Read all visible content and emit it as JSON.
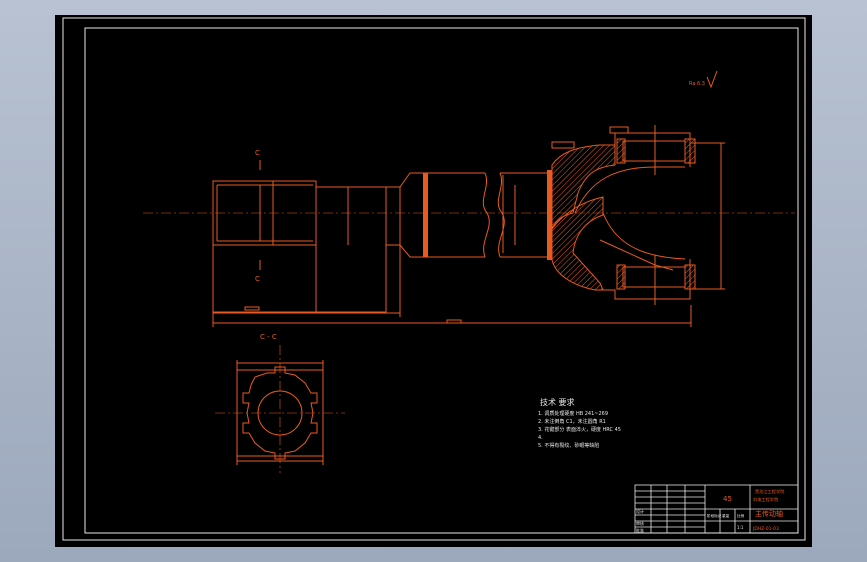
{
  "drawing": {
    "section_label_top": "C",
    "section_label_bottom": "C",
    "section_view_label": "C - C",
    "roughness_symbol": "Ra 6.3",
    "tech_req_title": "技术 要求",
    "tech_req_lines": [
      "1. 调质处理硬度 HB 241~269",
      "2. 未注倒角 C1，未注圆角 R1",
      "3. 花键部分 表面淬火，硬度 HRC 45",
      "4.",
      "5. 不得有裂纹、砂眼等缺陷"
    ],
    "title_block": {
      "material": "45",
      "school_line1": "黑龙江工程学院",
      "school_line2": "机电工程学院",
      "part_name": "主传动轴",
      "drawing_number": "JDHZ-01-03",
      "design_label": "设计",
      "check_label": "审核",
      "approve_label": "批准",
      "stage_label": "阶段标记",
      "weight_label": "重量",
      "scale_label": "比例",
      "scale_value": "1:1"
    }
  },
  "colors": {
    "line": "#e85a1f",
    "text": "#e8e8e8",
    "background": "#000000",
    "frame": "#b8c2d2"
  }
}
